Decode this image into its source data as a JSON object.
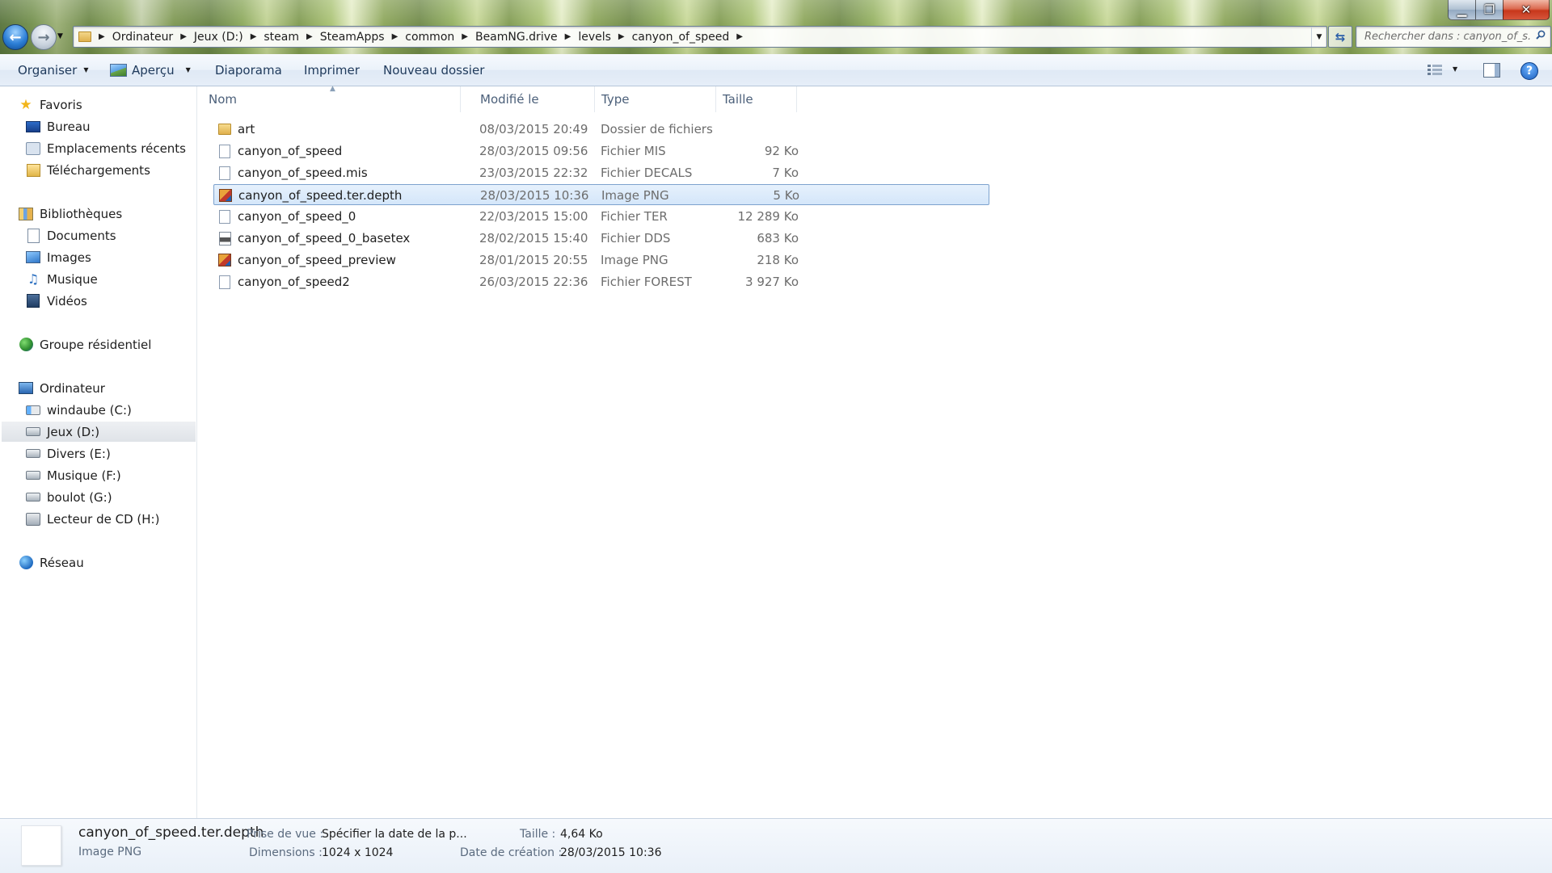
{
  "window": {
    "controls": {
      "minimize": "▁",
      "maximize": "❐",
      "close": "✕"
    }
  },
  "nav": {
    "back": "←",
    "forward": "→"
  },
  "address": {
    "breadcrumbs": [
      "Ordinateur",
      "Jeux (D:)",
      "steam",
      "SteamApps",
      "common",
      "BeamNG.drive",
      "levels",
      "canyon_of_speed"
    ]
  },
  "search": {
    "placeholder": "Rechercher dans : canyon_of_s..."
  },
  "toolbar": {
    "organize": "Organiser",
    "preview": "Aperçu",
    "slideshow": "Diaporama",
    "print": "Imprimer",
    "new_folder": "Nouveau dossier",
    "help": "?"
  },
  "sidebar": {
    "favorites": {
      "label": "Favoris",
      "items": [
        "Bureau",
        "Emplacements récents",
        "Téléchargements"
      ]
    },
    "libraries": {
      "label": "Bibliothèques",
      "items": [
        "Documents",
        "Images",
        "Musique",
        "Vidéos"
      ]
    },
    "homegroup": {
      "label": "Groupe résidentiel"
    },
    "computer": {
      "label": "Ordinateur",
      "items": [
        "windaube (C:)",
        "Jeux (D:)",
        "Divers (E:)",
        "Musique (F:)",
        "boulot (G:)",
        "Lecteur de CD (H:)"
      ]
    },
    "network": {
      "label": "Réseau"
    }
  },
  "columns": {
    "name": "Nom",
    "date": "Modifié le",
    "type": "Type",
    "size": "Taille"
  },
  "files": [
    {
      "name": "art",
      "date": "08/03/2015 20:49",
      "type": "Dossier de fichiers",
      "size": "",
      "icon": "folder-icon"
    },
    {
      "name": "canyon_of_speed",
      "date": "28/03/2015 09:56",
      "type": "Fichier MIS",
      "size": "92 Ko",
      "icon": "file-icon"
    },
    {
      "name": "canyon_of_speed.mis",
      "date": "23/03/2015 22:32",
      "type": "Fichier DECALS",
      "size": "7 Ko",
      "icon": "file-icon"
    },
    {
      "name": "canyon_of_speed.ter.depth",
      "date": "28/03/2015 10:36",
      "type": "Image PNG",
      "size": "5 Ko",
      "icon": "png-icon"
    },
    {
      "name": "canyon_of_speed_0",
      "date": "22/03/2015 15:00",
      "type": "Fichier TER",
      "size": "12 289 Ko",
      "icon": "file-icon"
    },
    {
      "name": "canyon_of_speed_0_basetex",
      "date": "28/02/2015 15:40",
      "type": "Fichier DDS",
      "size": "683 Ko",
      "icon": "dds-icon"
    },
    {
      "name": "canyon_of_speed_preview",
      "date": "28/01/2015 20:55",
      "type": "Image PNG",
      "size": "218 Ko",
      "icon": "png-icon"
    },
    {
      "name": "canyon_of_speed2",
      "date": "26/03/2015 22:36",
      "type": "Fichier FOREST",
      "size": "3 927 Ko",
      "icon": "file-icon"
    }
  ],
  "details": {
    "name": "canyon_of_speed.ter.depth",
    "type": "Image PNG",
    "date_taken_label": "Prise de vue :",
    "date_taken_value": "Spécifier la date de la p...",
    "dimensions_label": "Dimensions :",
    "dimensions_value": "1024 x 1024",
    "size_label": "Taille :",
    "size_value": "4,64 Ko",
    "created_label": "Date de création :",
    "created_value": "28/03/2015 10:36"
  },
  "colors": {
    "accent": "#1e395b",
    "selection": "#d4e6fa",
    "selection_border": "#7da2ce"
  }
}
